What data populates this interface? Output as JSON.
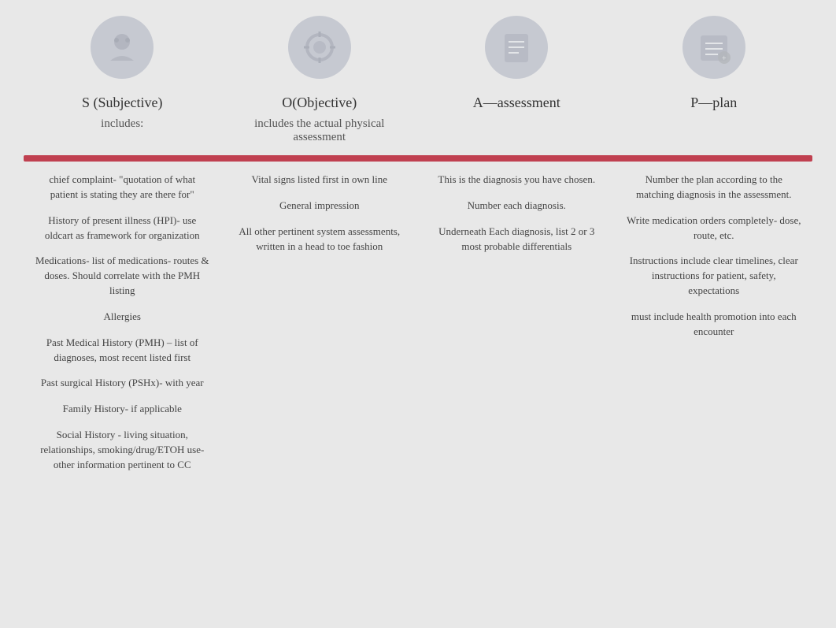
{
  "columns": [
    {
      "id": "subjective",
      "title": "S (Subjective)",
      "subtitle": "includes:",
      "icon": "S",
      "bullets": [
        "chief complaint- \"quotation of what patient is stating they are there for\"",
        "History of present illness (HPI)- use oldcart as framework for organization",
        "Medications- list of medications- routes & doses. Should correlate with the PMH listing",
        "Allergies",
        "Past Medical History (PMH) – list of diagnoses, most recent listed first",
        "Past surgical History (PSHx)- with year",
        "Family History- if applicable",
        "Social History - living situation, relationships, smoking/drug/ETOH use- other information pertinent to CC"
      ]
    },
    {
      "id": "objective",
      "title": "O(Objective)",
      "subtitle": "includes the actual physical assessment",
      "icon": "O",
      "bullets": [
        "Vital signs listed first in own line",
        "General impression",
        "All other pertinent system assessments, written in a head to toe fashion"
      ]
    },
    {
      "id": "assessment",
      "title": "A—assessment",
      "subtitle": "",
      "icon": "A",
      "bullets": [
        "This is the diagnosis you have chosen.",
        "Number each diagnosis.",
        "Underneath Each diagnosis, list 2 or 3 most probable differentials"
      ]
    },
    {
      "id": "plan",
      "title": "P—plan",
      "subtitle": "",
      "icon": "P",
      "bullets": [
        "Number the plan according to the matching diagnosis in the assessment.",
        "Write medication orders completely- dose, route, etc.",
        "Instructions include clear timelines, clear instructions for patient, safety, expectations",
        "must include       health promotion into each encounter"
      ]
    }
  ]
}
